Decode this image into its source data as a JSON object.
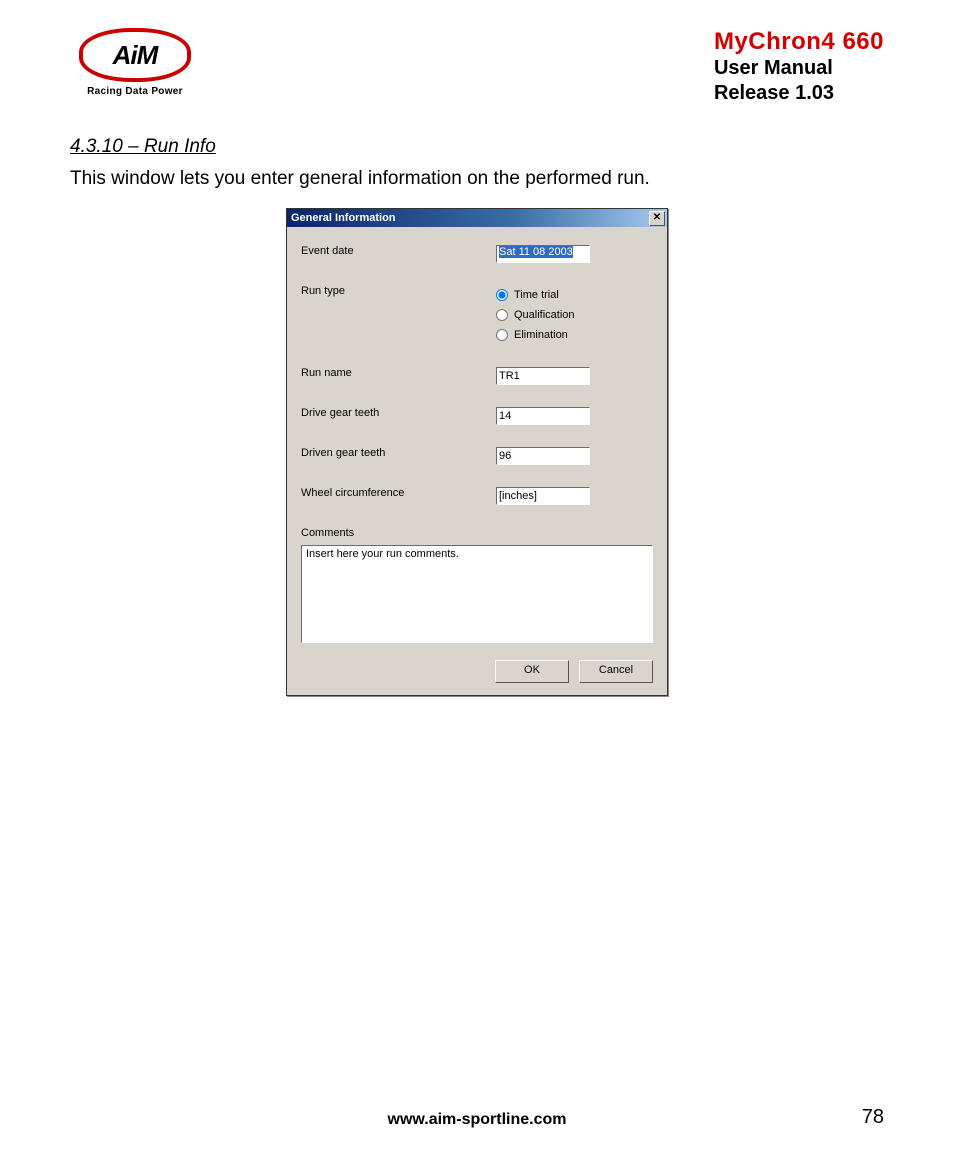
{
  "header": {
    "logo_text": "AiM",
    "logo_tagline": "Racing Data Power",
    "product": "MyChron4 660",
    "subtitle_line1": "User Manual",
    "subtitle_line2": "Release 1.03"
  },
  "section": {
    "heading": "4.3.10 – Run Info",
    "body": "This window lets you enter general information on the performed run."
  },
  "dialog": {
    "title": "General Information",
    "close_glyph": "✕",
    "fields": {
      "event_date_label": "Event date",
      "event_date_value": "Sat 11 08 2003",
      "run_type_label": "Run type",
      "run_type_options": [
        "Time trial",
        "Qualification",
        "Elimination"
      ],
      "run_type_selected": "Time trial",
      "run_name_label": "Run name",
      "run_name_value": "TR1",
      "drive_gear_label": "Drive gear teeth",
      "drive_gear_value": "14",
      "driven_gear_label": "Driven gear teeth",
      "driven_gear_value": "96",
      "wheel_label": "Wheel circumference",
      "wheel_value": "[inches]",
      "comments_label": "Comments",
      "comments_value": "Insert here your run comments."
    },
    "buttons": {
      "ok": "OK",
      "cancel": "Cancel"
    }
  },
  "footer": {
    "url": "www.aim-sportline.com",
    "page_number": "78"
  }
}
